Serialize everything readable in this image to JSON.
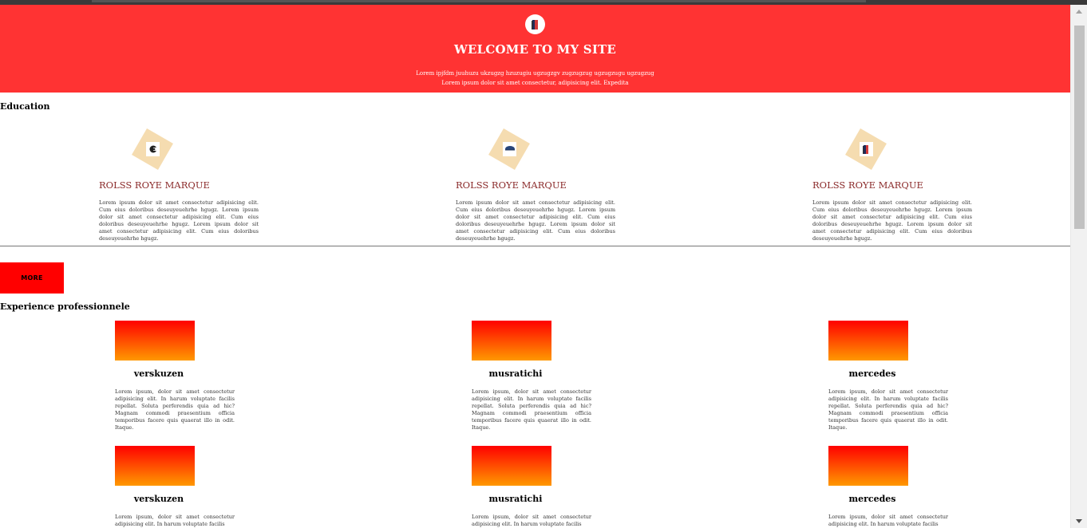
{
  "header": {
    "title": "WELCOME TO MY SITE",
    "subtitle_line1": "Lorem ipjfdm juuhuzu ukzugzg hzuzugiu ugzugzgv zugzugzug ugzugzugu ugzugzug",
    "subtitle_line2": "Lorem ipsum dolor sit amet consectetur, adipisicing elit. Expedita",
    "logo_icon": "book-logo-icon"
  },
  "education": {
    "heading": "Education",
    "cards": [
      {
        "icon": "cap-icon",
        "name": "ROLSS ROYE MARQUE",
        "description": "Lorem ipsum dolor sit amet consectetur adipisicing elit. Cum eius doloribus deseuyeuehrhe hgugz. Lorem ipsum dolor sit amet consectetur adipisicing elit. Cum eius doloribus deseuyeuehrhe hgugz. Lorem ipsum dolor sit amet consectetur adipisicing elit. Cum eius doloribus deseuyeuehrhe hgugz."
      },
      {
        "icon": "hat-icon",
        "name": "ROLSS ROYE MARQUE",
        "description": "Lorem ipsum dolor sit amet consectetur adipisicing elit. Cum eius doloribus deseuyeuehrhe hgugz. Lorem ipsum dolor sit amet consectetur adipisicing elit. Cum eius doloribus deseuyeuehrhe hgugz. Lorem ipsum dolor sit amet consectetur adipisicing elit. Cum eius doloribus deseuyeuehrhe hgugz."
      },
      {
        "icon": "book-icon",
        "name": "ROLSS ROYE MARQUE",
        "description": "Lorem ipsum dolor sit amet consectetur adipisicing elit. Cum eius doloribus deseuyeuehrhe hgugz. Lorem ipsum dolor sit amet consectetur adipisicing elit. Cum eius doloribus deseuyeuehrhe hgugz. Lorem ipsum dolor sit amet consectetur adipisicing elit. Cum eius doloribus deseuyeuehrhe hgugz."
      }
    ]
  },
  "more_button": {
    "label": "MORE"
  },
  "experience": {
    "heading": "Experience professionnele",
    "cards": [
      {
        "name": "verskuzen",
        "description": "Lorem ipsum, dolor sit amet consectetur adipisicing elit. In harum voluptate facilis repellat. Soluta perferendis quia ad hic? Magnam commodi praesentium officia temporibus facere quis quaerat illo in odit. Itaque."
      },
      {
        "name": "musratichi",
        "description": "Lorem ipsum, dolor sit amet consectetur adipisicing elit. In harum voluptate facilis repellat. Soluta perferendis quia ad hic? Magnam commodi praesentium officia temporibus facere quis quaerat illo in odit. Itaque."
      },
      {
        "name": "mercedes",
        "description": "Lorem ipsum, dolor sit amet consectetur adipisicing elit. In harum voluptate facilis repellat. Soluta perferendis quia ad hic? Magnam commodi praesentium officia temporibus facere quis quaerat illo in odit. Itaque."
      },
      {
        "name": "verskuzen",
        "description": "Lorem ipsum, dolor sit amet consectetur adipisicing elit. In harum voluptate facilis"
      },
      {
        "name": "musratichi",
        "description": "Lorem ipsum, dolor sit amet consectetur adipisicing elit. In harum voluptate facilis"
      },
      {
        "name": "mercedes",
        "description": "Lorem ipsum, dolor sit amet consectetur adipisicing elit. In harum voluptate facilis"
      }
    ]
  },
  "colors": {
    "hero_bg": "#ff3333",
    "accent_red": "#ff0000",
    "gradient_end": "#ff9900",
    "edu_title": "#8b2b2b",
    "diamond": "#f5dcb0"
  }
}
